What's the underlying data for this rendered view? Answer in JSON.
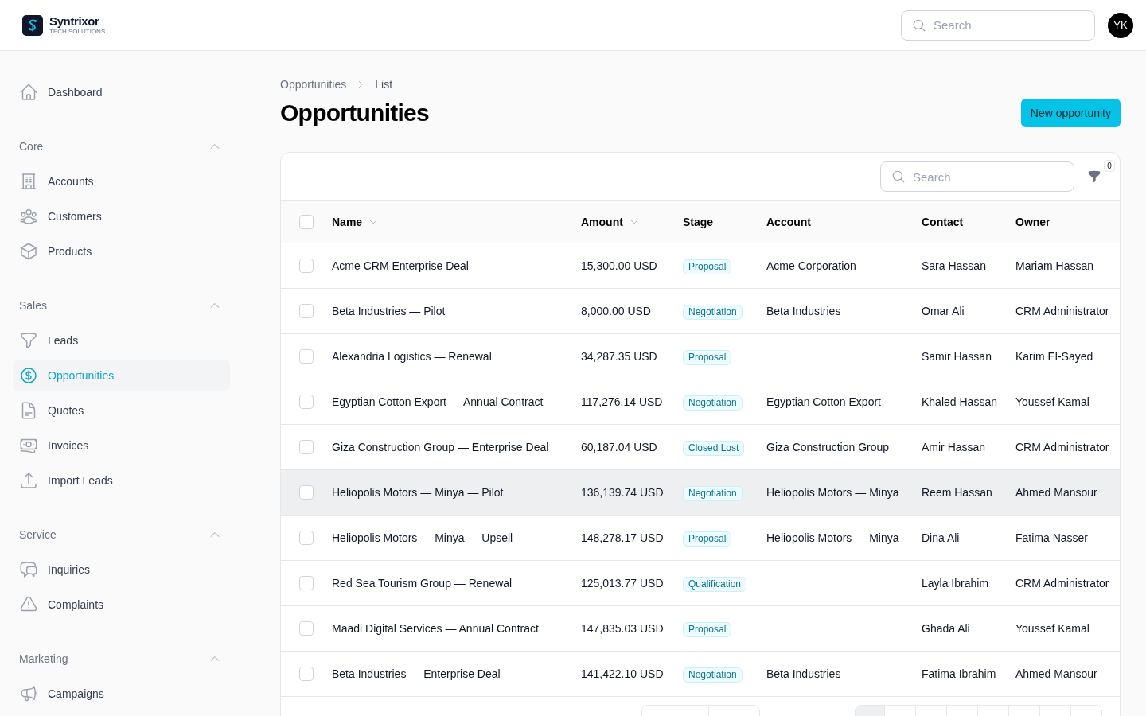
{
  "header": {
    "brand": {
      "name": "Syntrixor",
      "tagline": "TECH SOLUTIONS"
    },
    "search": {
      "placeholder": "Search"
    },
    "avatar": {
      "initials": "YK"
    }
  },
  "sidebar": {
    "items": [
      {
        "label": "Dashboard",
        "selected": false
      }
    ],
    "sections": [
      {
        "title": "Core",
        "expanded": true,
        "items": [
          {
            "label": "Accounts",
            "selected": false
          },
          {
            "label": "Customers",
            "selected": false
          },
          {
            "label": "Products",
            "selected": false
          }
        ]
      },
      {
        "title": "Sales",
        "expanded": true,
        "items": [
          {
            "label": "Leads",
            "selected": false
          },
          {
            "label": "Opportunities",
            "selected": true
          },
          {
            "label": "Quotes",
            "selected": false
          },
          {
            "label": "Invoices",
            "selected": false
          },
          {
            "label": "Import Leads",
            "selected": false
          }
        ]
      },
      {
        "title": "Service",
        "expanded": true,
        "items": [
          {
            "label": "Inquiries",
            "selected": false
          },
          {
            "label": "Complaints",
            "selected": false
          }
        ]
      },
      {
        "title": "Marketing",
        "expanded": true,
        "items": [
          {
            "label": "Campaigns",
            "selected": false
          }
        ]
      }
    ]
  },
  "breadcrumb": [
    "Opportunities",
    "List"
  ],
  "page_title": "Opportunities",
  "primary_button": "New opportunity",
  "table": {
    "search": {
      "placeholder": "Search"
    },
    "filter_count": "0",
    "select_all": {
      "checked": false
    },
    "columns": [
      {
        "label": "Name",
        "sortable": true
      },
      {
        "label": "Amount",
        "sortable": true
      },
      {
        "label": "Stage",
        "sortable": false
      },
      {
        "label": "Account",
        "sortable": false
      },
      {
        "label": "Contact",
        "sortable": false
      },
      {
        "label": "Owner",
        "sortable": false
      }
    ],
    "rows": [
      {
        "checked": false,
        "highlighted": false,
        "name": "Acme CRM Enterprise Deal",
        "amount": "15,300.00 USD",
        "stage": "Proposal",
        "account": "Acme Corporation",
        "contact": "Sara Hassan",
        "owner": "Mariam Hassan"
      },
      {
        "checked": false,
        "highlighted": false,
        "name": "Beta Industries — Pilot",
        "amount": "8,000.00 USD",
        "stage": "Negotiation",
        "account": "Beta Industries",
        "contact": "Omar Ali",
        "owner": "CRM Administrator"
      },
      {
        "checked": false,
        "highlighted": false,
        "name": "Alexandria Logistics — Renewal",
        "amount": "34,287.35 USD",
        "stage": "Proposal",
        "contact": "Samir Hassan",
        "owner": "Karim El-Sayed"
      },
      {
        "checked": false,
        "highlighted": false,
        "name": "Egyptian Cotton Export — Annual Contract",
        "amount": "117,276.14 USD",
        "stage": "Negotiation",
        "account": "Egyptian Cotton Export",
        "contact": "Khaled Hassan",
        "owner": "Youssef Kamal"
      },
      {
        "checked": false,
        "highlighted": false,
        "name": "Giza Construction Group — Enterprise Deal",
        "amount": "60,187.04 USD",
        "stage": "Closed Lost",
        "account": "Giza Construction Group",
        "contact": "Amir Hassan",
        "owner": "CRM Administrator"
      },
      {
        "checked": false,
        "highlighted": true,
        "name": "Heliopolis Motors — Minya — Pilot",
        "amount": "136,139.74 USD",
        "stage": "Negotiation",
        "account": "Heliopolis Motors — Minya",
        "contact": "Reem Hassan",
        "owner": "Ahmed Mansour"
      },
      {
        "checked": false,
        "highlighted": false,
        "name": "Heliopolis Motors — Minya — Upsell",
        "amount": "148,278.17 USD",
        "stage": "Proposal",
        "account": "Heliopolis Motors — Minya",
        "contact": "Dina Ali",
        "owner": "Fatima Nasser"
      },
      {
        "checked": false,
        "highlighted": false,
        "name": "Red Sea Tourism Group — Renewal",
        "amount": "125,013.77 USD",
        "stage": "Qualification",
        "contact": "Layla Ibrahim",
        "owner": "CRM Administrator"
      },
      {
        "checked": false,
        "highlighted": false,
        "name": "Maadi Digital Services — Annual Contract",
        "amount": "147,835.03 USD",
        "stage": "Proposal",
        "contact": "Ghada Ali",
        "owner": "Youssef Kamal"
      },
      {
        "checked": false,
        "highlighted": false,
        "name": "Beta Industries — Enterprise Deal",
        "amount": "141,422.10 USD",
        "stage": "Negotiation",
        "account": "Beta Industries",
        "contact": "Fatima Ibrahim",
        "owner": "Ahmed Mansour"
      }
    ]
  },
  "pagination": {
    "button_groups": [
      {
        "buttons": [
          {
            "disabled": false
          },
          {
            "disabled": false
          }
        ]
      },
      {
        "buttons": [
          {
            "disabled": true
          },
          {
            "disabled": false
          },
          {
            "disabled": false
          },
          {
            "disabled": false
          },
          {
            "disabled": false
          },
          {
            "disabled": false
          },
          {
            "disabled": false
          },
          {
            "disabled": false
          }
        ]
      }
    ]
  }
}
